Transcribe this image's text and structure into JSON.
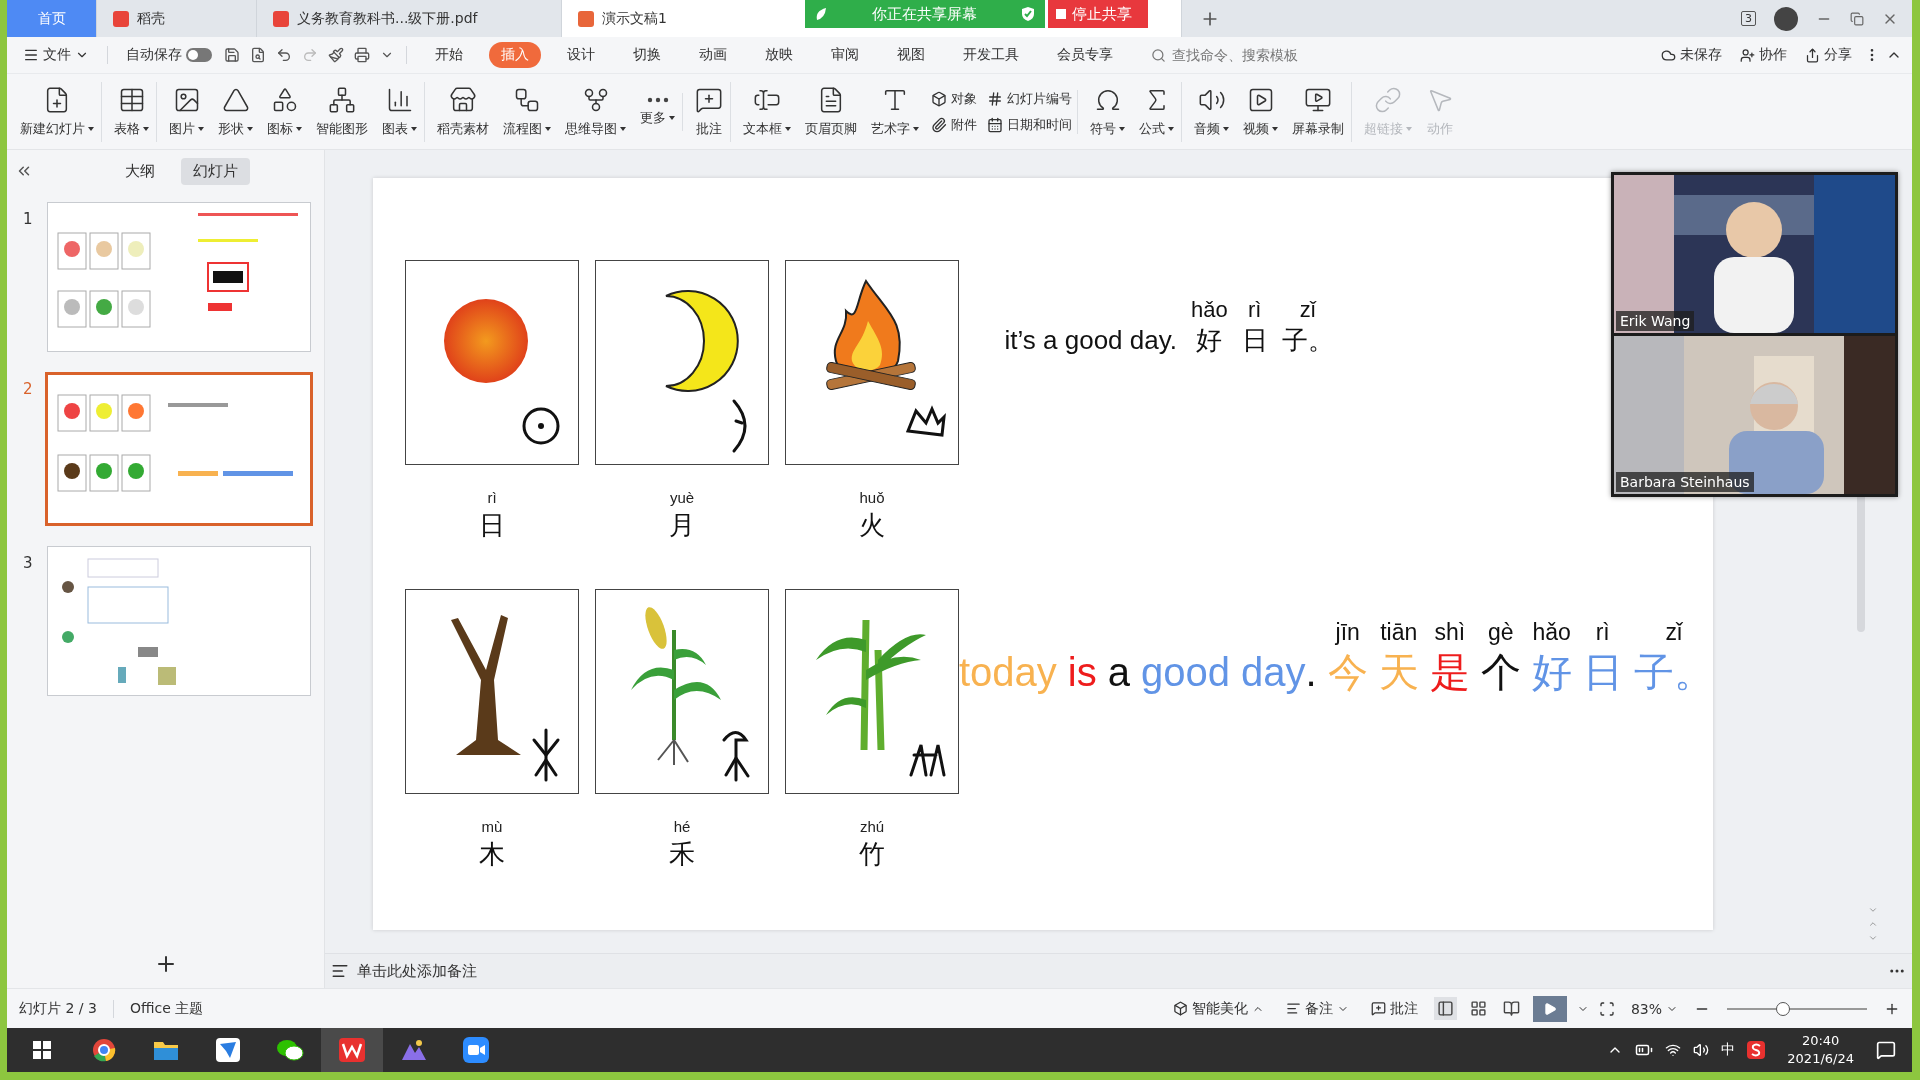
{
  "tabs": [
    {
      "label": "首页",
      "selected": false,
      "kind": "home"
    },
    {
      "label": "稻壳",
      "selected": false,
      "kind": "docer"
    },
    {
      "label": "义务教育教科书...级下册.pdf",
      "selected": false,
      "kind": "pdf"
    },
    {
      "label": "演示文稿1",
      "selected": true,
      "kind": "slides"
    }
  ],
  "share_banner": {
    "status": "你正在共享屏幕",
    "stop": "停止共享"
  },
  "window_badge": "3",
  "menu": {
    "file": "文件",
    "autosave": "自动保存",
    "autosave_on": false,
    "tabs": [
      {
        "label": "开始",
        "selected": false
      },
      {
        "label": "插入",
        "selected": true
      },
      {
        "label": "设计",
        "selected": false
      },
      {
        "label": "切换",
        "selected": false
      },
      {
        "label": "动画",
        "selected": false
      },
      {
        "label": "放映",
        "selected": false
      },
      {
        "label": "审阅",
        "selected": false
      },
      {
        "label": "视图",
        "selected": false
      },
      {
        "label": "开发工具",
        "selected": false
      },
      {
        "label": "会员专享",
        "selected": false
      }
    ],
    "search_placeholder": "查找命令、搜索模板",
    "actions": [
      "未保存",
      "协作",
      "分享"
    ]
  },
  "ribbon": [
    {
      "kind": "big",
      "label": "新建幻灯片",
      "dropdown": true,
      "divider": true
    },
    {
      "kind": "big",
      "label": "表格",
      "dropdown": true,
      "divider": true
    },
    {
      "kind": "big",
      "label": "图片",
      "dropdown": true
    },
    {
      "kind": "big",
      "label": "形状",
      "dropdown": true
    },
    {
      "kind": "big",
      "label": "图标",
      "dropdown": true
    },
    {
      "kind": "big",
      "label": "智能图形"
    },
    {
      "kind": "big",
      "label": "图表",
      "dropdown": true,
      "divider": true
    },
    {
      "kind": "big",
      "label": "稻壳素材"
    },
    {
      "kind": "big",
      "label": "流程图",
      "dropdown": true
    },
    {
      "kind": "big",
      "label": "思维导图",
      "dropdown": true
    },
    {
      "kind": "big",
      "label": "更多",
      "dropdown": true,
      "divider": true
    },
    {
      "kind": "big",
      "label": "批注",
      "divider": true
    },
    {
      "kind": "big",
      "label": "文本框",
      "dropdown": true
    },
    {
      "kind": "big",
      "label": "页眉页脚"
    },
    {
      "kind": "big",
      "label": "艺术字",
      "dropdown": true
    },
    {
      "kind": "pair",
      "items": [
        "对象",
        "附件"
      ]
    },
    {
      "kind": "pair",
      "items": [
        "幻灯片编号",
        "日期和时间"
      ],
      "divider": true
    },
    {
      "kind": "big",
      "label": "符号",
      "dropdown": true
    },
    {
      "kind": "big",
      "label": "公式",
      "dropdown": true,
      "divider": true
    },
    {
      "kind": "big",
      "label": "音频",
      "dropdown": true
    },
    {
      "kind": "big",
      "label": "视频",
      "dropdown": true
    },
    {
      "kind": "big",
      "label": "屏幕录制",
      "divider": true
    },
    {
      "kind": "big",
      "label": "超链接",
      "dropdown": true,
      "disabled": true
    },
    {
      "kind": "big",
      "label": "动作",
      "disabled": true
    }
  ],
  "panel": {
    "tabs": [
      {
        "label": "大纲",
        "selected": false
      },
      {
        "label": "幻灯片",
        "selected": true
      }
    ],
    "slides": [
      {
        "number": "1",
        "selected": false,
        "kind": "faces"
      },
      {
        "number": "2",
        "selected": true,
        "kind": "nature"
      },
      {
        "number": "3",
        "selected": false,
        "kind": "worksheet"
      }
    ]
  },
  "slide": {
    "cards": [
      {
        "kind": "sun",
        "pinyin": "rì",
        "character": "日"
      },
      {
        "kind": "moon",
        "pinyin": "yuè",
        "character": "月"
      },
      {
        "kind": "fire",
        "pinyin": "huǒ",
        "character": "火"
      },
      {
        "kind": "tree",
        "pinyin": "mù",
        "character": "木"
      },
      {
        "kind": "grain",
        "pinyin": "hé",
        "character": "禾"
      },
      {
        "kind": "bamboo",
        "pinyin": "zhú",
        "character": "竹"
      }
    ],
    "line_1": [
      {
        "text": "it’s a good day."
      },
      {
        "text": "好",
        "pinyin": "hǎo"
      },
      {
        "text": "日",
        "pinyin": "rì"
      },
      {
        "text": "子。",
        "pinyin": "zǐ"
      }
    ],
    "line_2": [
      {
        "text": "today",
        "color": "#f8b250"
      },
      {
        "text": "is",
        "color": "#ee1c1c"
      },
      {
        "text": "a",
        "color": "#111111"
      },
      {
        "text": "good day",
        "color": "#6194e6"
      },
      {
        "text": ".",
        "color": "#111111",
        "joined": true
      },
      {
        "text": "今",
        "pinyin": "jīn",
        "color": "#f8b250"
      },
      {
        "text": "天",
        "pinyin": "tiān",
        "color": "#f8b250"
      },
      {
        "text": "是",
        "pinyin": "shì",
        "color": "#ee1c1c"
      },
      {
        "text": "个",
        "pinyin": "gè",
        "color": "#111111"
      },
      {
        "text": "好",
        "pinyin": "hǎo",
        "color": "#6194e6"
      },
      {
        "text": "日",
        "pinyin": "rì",
        "color": "#6194e6"
      },
      {
        "text": "子。",
        "pinyin": "zǐ",
        "color": "#6194e6"
      }
    ]
  },
  "video": [
    {
      "name": "Erik Wang",
      "kind": "closet"
    },
    {
      "name": "Barbara Steinhaus",
      "kind": "hallway"
    }
  ],
  "notes_placeholder": "单击此处添加备注",
  "status": {
    "slide": "幻灯片 2 / 3",
    "theme": "Office 主题",
    "beautify": "智能美化",
    "notes": "备注",
    "comment": "批注",
    "zoom": "83%",
    "zoom_slider": {
      "level": 0.4
    }
  },
  "taskbar": {
    "ime": "中",
    "time": "20:40",
    "date": "2021/6/24"
  }
}
